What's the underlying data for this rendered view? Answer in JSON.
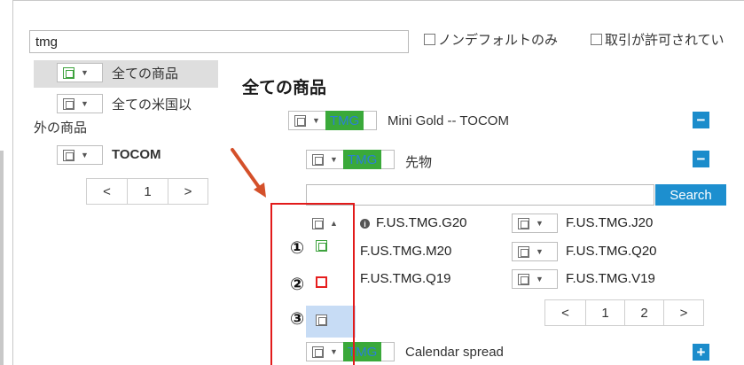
{
  "filter": {
    "search_value": "tmg",
    "non_default_only_label": "ノンデフォルトのみ",
    "trading_allowed_label": "取引が許可されてい"
  },
  "left_tree": {
    "all_products": "全ての商品",
    "non_us_line1": "全ての米国以",
    "non_us_line2": "外の商品",
    "tocom": "TOCOM",
    "pager": {
      "prev": "<",
      "page": "1",
      "next": ">"
    }
  },
  "main": {
    "heading": "全ての商品",
    "product_tag": "TMG",
    "product_name": "Mini Gold -- TOCOM",
    "product_toggle": "−",
    "futures_tag": "TMG",
    "futures_name": "先物",
    "futures_toggle": "−",
    "search_button": "Search",
    "contracts": [
      "F.US.TMG.G20",
      "F.US.TMG.J20",
      "F.US.TMG.M20",
      "F.US.TMG.Q20",
      "F.US.TMG.Q19",
      "F.US.TMG.V19"
    ],
    "info_glyph": "i",
    "pager": {
      "prev": "<",
      "page1": "1",
      "page2": "2",
      "next": ">"
    },
    "spread_tag": "TMG",
    "spread_name": "Calendar spread",
    "spread_toggle": "+"
  },
  "annotations": {
    "n1": "①",
    "n2": "②",
    "n3": "③"
  },
  "colors": {
    "accent_blue": "#1b8ccb",
    "tag_green": "#3aa93a",
    "annotation_red": "#e21b1b",
    "arrow": "#d4502a"
  },
  "icons": {
    "dropdown": "▼",
    "collapse": "▲"
  }
}
